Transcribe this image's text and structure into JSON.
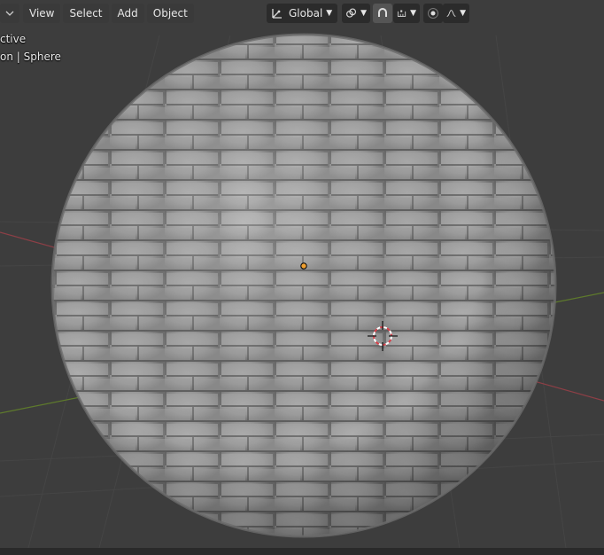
{
  "header": {
    "menus": [
      "View",
      "Select",
      "Add",
      "Object"
    ],
    "orientation": "Global"
  },
  "overlay": {
    "mode_text": "ctive",
    "object_text": "on | Sphere"
  },
  "colors": {
    "viewport_bg": "#3d3d3d",
    "grid_line": "#454545",
    "x_axis": "#8c3f46",
    "y_axis": "#5e7a2c",
    "origin_dot": "#f0a030",
    "cursor_red": "#d8404a",
    "sphere": "#9a9a9a"
  },
  "icons": [
    "transform-orientation-icon",
    "pivot-link-icon",
    "snap-magnet-icon",
    "snap-increment-icon",
    "proportional-edit-icon",
    "falloff-curve-icon"
  ]
}
